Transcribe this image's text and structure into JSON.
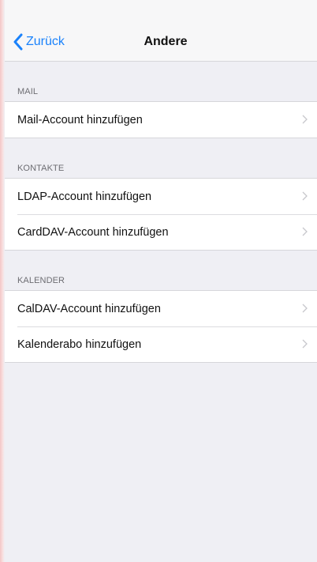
{
  "nav": {
    "back_label": "Zurück",
    "title": "Andere"
  },
  "sections": [
    {
      "header": "MAIL",
      "items": [
        {
          "label": "Mail-Account hinzufügen"
        }
      ]
    },
    {
      "header": "KONTAKTE",
      "items": [
        {
          "label": "LDAP-Account hinzufügen"
        },
        {
          "label": "CardDAV-Account hinzufügen"
        }
      ]
    },
    {
      "header": "KALENDER",
      "items": [
        {
          "label": "CalDAV-Account hinzufügen"
        },
        {
          "label": "Kalenderabo hinzufügen"
        }
      ]
    }
  ],
  "icons": {
    "back": "chevron-left-icon",
    "disclosure": "chevron-right-icon"
  },
  "colors": {
    "accent": "#1a82fb",
    "background": "#efeff4"
  }
}
